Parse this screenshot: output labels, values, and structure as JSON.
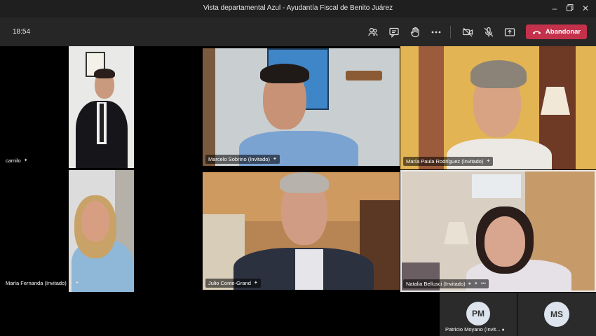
{
  "window": {
    "title": "Vista departamental Azul - Ayudantía Fiscal de Benito Juárez"
  },
  "toolbar": {
    "time": "18:54",
    "leave_label": "Abandonar",
    "icons": [
      "participants-icon",
      "chat-icon",
      "raise-hand-icon",
      "more-icon",
      "camera-off-icon",
      "mic-off-icon",
      "share-icon",
      "phone-hangup-icon"
    ]
  },
  "participants": {
    "camilo": {
      "name": "camilo"
    },
    "marcelo": {
      "name": "Marcelo Sobrino (Invitado)"
    },
    "maria_paula": {
      "name": "María Paula Rodríguez (Invitado)"
    },
    "maria_fernanda": {
      "name": "María Fernanda (Invitado)"
    },
    "julio": {
      "name": "Julio Conte-Grand"
    },
    "natalia": {
      "name": "Natalia Bellusci (Invitado)"
    },
    "patricio": {
      "initials": "PM",
      "name": "Patricio Moyano (Invit..."
    },
    "ms": {
      "initials": "MS"
    }
  },
  "colors": {
    "leave": "#c4314b",
    "toolbar": "#262626",
    "titlebar": "#1f1f1f",
    "active_speaker_border": "#e8e8e8"
  }
}
